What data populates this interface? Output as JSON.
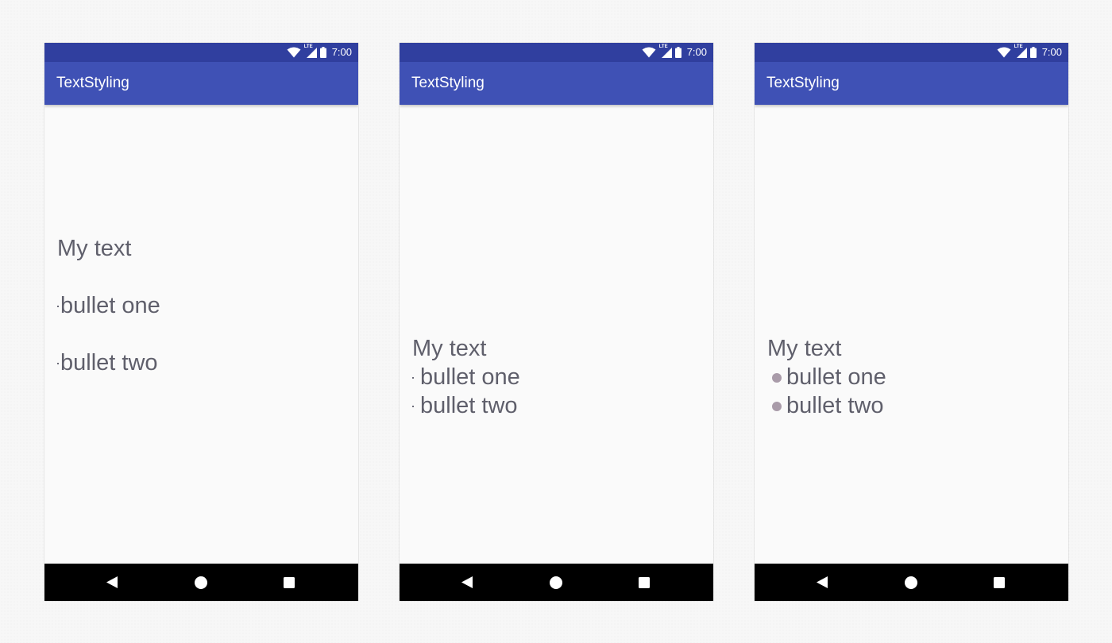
{
  "status_bar": {
    "network_label": "LTE",
    "time": "7:00"
  },
  "app_bar": {
    "title": "TextStyling"
  },
  "screens": [
    {
      "variant": "separate-paragraphs",
      "heading": "My text",
      "bullets": [
        "bullet one",
        "bullet two"
      ]
    },
    {
      "variant": "small-bullet-span",
      "heading": "My text",
      "bullets": [
        "bullet one",
        "bullet two"
      ]
    },
    {
      "variant": "custom-bullet-span",
      "heading": "My text",
      "bullets": [
        "bullet one",
        "bullet two"
      ]
    }
  ],
  "nav_bar": {
    "buttons": [
      "back",
      "home",
      "recents"
    ]
  },
  "colors": {
    "status_bar": "#303f9f",
    "app_bar": "#3f51b5",
    "text": "#5f5f6b",
    "custom_bullet": "#a99ba9"
  }
}
